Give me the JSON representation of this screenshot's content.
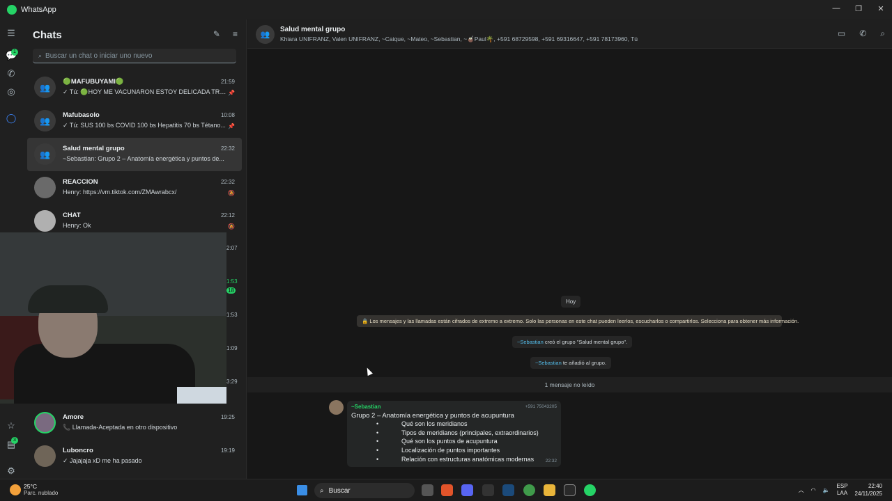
{
  "window": {
    "title": "WhatsApp",
    "controls": [
      "—",
      "❐",
      "✕"
    ]
  },
  "rail": {
    "badges": {
      "chats": "1",
      "status": "3"
    }
  },
  "sidebar": {
    "title": "Chats",
    "search_placeholder": "Buscar un chat o iniciar uno nuevo",
    "chats": [
      {
        "name": "🟢MAFUBUYAMI🟢",
        "time": "21:59",
        "preview": "✓ Tú: 🟢HOY ME VACUNARON ESTOY DELICADA TRA...",
        "flag": "📌"
      },
      {
        "name": "Mafubasolo",
        "time": "10:08",
        "preview": "✓ Tú: SUS 100 bs COVID 100 bs Hepatitis 70 bs Tétano...",
        "flag": "📌"
      },
      {
        "name": "Salud mental grupo",
        "time": "22:32",
        "preview": "~Sebastian: Grupo 2 – Anatomía energética y puntos de...",
        "flag": ""
      },
      {
        "name": "REACCION",
        "time": "22:32",
        "preview": "Henry: https://vm.tiktok.com/ZMAwrabcx/",
        "flag": "🔕"
      },
      {
        "name": "CHAT",
        "time": "22:12",
        "preview": "Henry: Ok",
        "flag": "🔕"
      }
    ],
    "hidden_times": [
      "2:07",
      "1:53",
      "18",
      "1:53",
      "1:09",
      "3:29"
    ],
    "chats_bottom": [
      {
        "name": "Amore",
        "time": "19:25",
        "preview": "📞 Llamada-Aceptada en otro dispositivo"
      },
      {
        "name": "Luboncro",
        "time": "19:19",
        "preview": "✓ Jajajaja xD me ha pasado"
      }
    ]
  },
  "chat": {
    "name": "Salud mental grupo",
    "members": "Khiara UNIFRANZ, Valen UNIFRANZ, ~Caique, ~Mateo, ~Sebastian, ~🧉Paul🌴, +591 68729598, +591 69316647, +591 78173960, Tú",
    "day": "Hoy",
    "encryption": "🔒 Los mensajes y las llamadas están cifrados de extremo a extremo. Solo las personas en este chat pueden leerlos, escucharlos o compartirlos. Selecciona para obtener más información.",
    "created_by": "~Sebastian",
    "created_text": " creó el grupo \"Salud mental grupo\".",
    "added_by": "~Sebastian",
    "added_text": " te añadió al grupo.",
    "unread": "1 mensaje no leído",
    "message": {
      "sender": "~Sebastian",
      "phone": "+591 75043205",
      "title": "Grupo 2 – Anatomía energética y puntos de acupuntura",
      "items": [
        "Qué son los meridianos",
        "Tipos de meridianos (principales, extraordinarios)",
        "Qué son los puntos de acupuntura",
        "Localización de puntos importantes",
        "Relación con estructuras anatómicas modernas"
      ],
      "time": "22:32"
    }
  },
  "taskbar": {
    "temp": "25°C",
    "weather": "Parc. nublado",
    "search": "Buscar",
    "lang1": "ESP",
    "lang2": "LAA",
    "time": "22:40",
    "date": "24/11/2025"
  }
}
